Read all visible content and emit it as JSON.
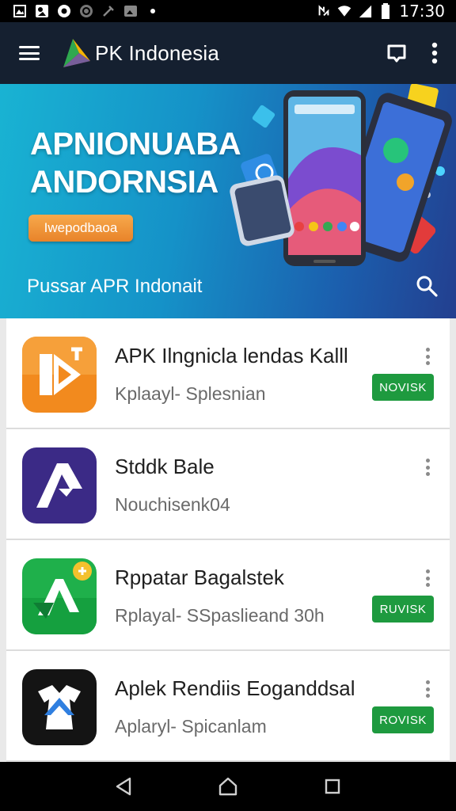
{
  "status_bar": {
    "time": "17:30",
    "left_icons": [
      "gallery-notification-icon",
      "photo-notification-icon",
      "record-notification-icon",
      "sync-notification-icon",
      "tool-notification-icon",
      "image-notification-icon",
      "dot-notification-icon"
    ],
    "right_icons": [
      "nfc-icon",
      "wifi-icon",
      "signal-icon",
      "battery-icon"
    ]
  },
  "app_bar": {
    "title": "PK Indonesia",
    "menu_icon": "menu-icon",
    "actions": [
      "notification-icon",
      "more-vert-icon"
    ]
  },
  "hero": {
    "title_line1": "APNIONUABA",
    "title_line2": "ANDORNSIA",
    "button_label": "Iwepodbaoa",
    "search_text": "Pussar APR Indonait",
    "search_icon": "search-icon"
  },
  "apps": [
    {
      "title": "APK Ilngnicla lendas Kalll",
      "subtitle": "Kplaayl- Splesnian",
      "badge": "NOVISK",
      "icon": "orange-play-app-icon"
    },
    {
      "title": "Stddk Bale",
      "subtitle": "Nouchisenk04",
      "badge": "",
      "icon": "purple-arrow-app-icon"
    },
    {
      "title": "Rppatar Bagalstek",
      "subtitle": "Rplayal- SSpaslieand 30h",
      "badge": "RUVISK",
      "icon": "green-chat-app-icon"
    },
    {
      "title": "Aplek Rendiis Eoganddsal",
      "subtitle": "Aplaryl- Spicanlam",
      "badge": "ROVISK",
      "icon": "black-shirt-app-icon"
    }
  ],
  "nav_bar": {
    "buttons": [
      "back-icon",
      "home-icon",
      "recents-icon"
    ]
  },
  "colors": {
    "app_bar": "#152030",
    "badge": "#1e9a3f",
    "hero_button": "#e8832a"
  }
}
